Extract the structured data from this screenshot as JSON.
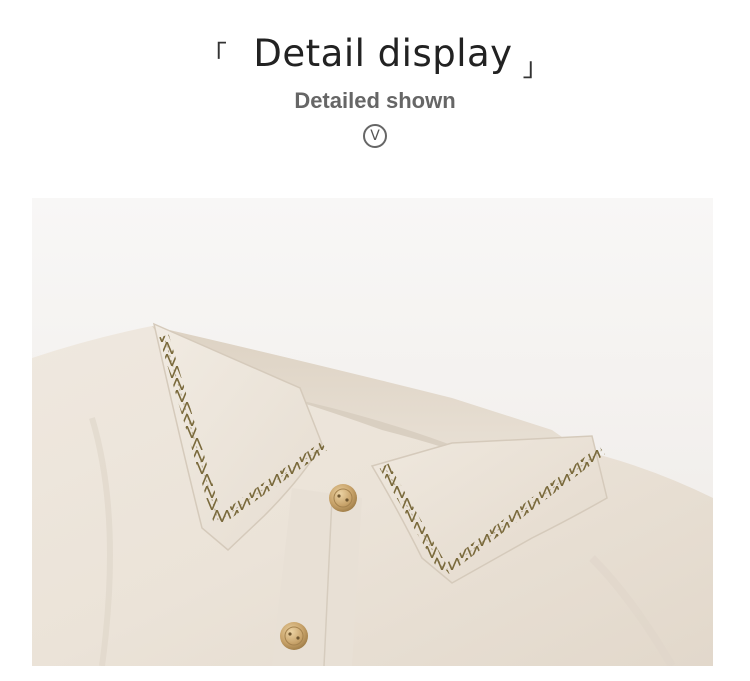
{
  "heading": {
    "left_bracket": "「",
    "title": "Detail display",
    "right_bracket": "」"
  },
  "subheading": "Detailed shown",
  "chevron_icon_glyph": "V",
  "colors": {
    "title": "#222222",
    "subtitle": "#666666",
    "fabric": "#ede6dd",
    "stitching": "#7a6a3c",
    "button": "#c8a36a"
  }
}
